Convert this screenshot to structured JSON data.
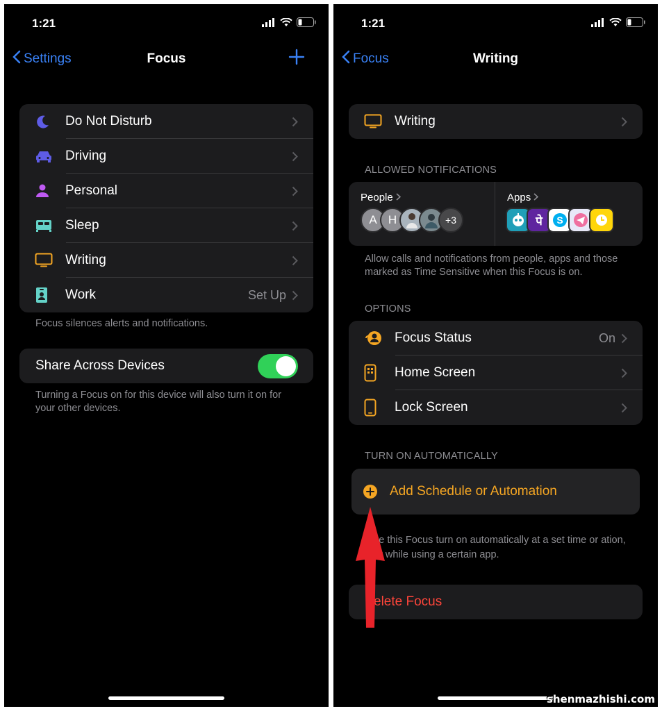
{
  "colors": {
    "accent_blue": "#3a82f7",
    "accent_orange": "#f5a623",
    "destructive_red": "#ff453a",
    "toggle_green": "#30d158"
  },
  "left": {
    "status": {
      "time": "1:21"
    },
    "nav": {
      "back_label": "Settings",
      "title": "Focus"
    },
    "focus_items": [
      {
        "label": "Do Not Disturb",
        "icon": "moon-icon",
        "value": ""
      },
      {
        "label": "Driving",
        "icon": "car-icon",
        "value": ""
      },
      {
        "label": "Personal",
        "icon": "person-icon",
        "value": ""
      },
      {
        "label": "Sleep",
        "icon": "bed-icon",
        "value": ""
      },
      {
        "label": "Writing",
        "icon": "monitor-icon",
        "value": ""
      },
      {
        "label": "Work",
        "icon": "badge-icon",
        "value": "Set Up"
      }
    ],
    "focus_footnote": "Focus silences alerts and notifications.",
    "share": {
      "label": "Share Across Devices",
      "enabled": true
    },
    "share_footnote": "Turning a Focus on for this device will also turn it on for your other devices."
  },
  "right": {
    "status": {
      "time": "1:21"
    },
    "nav": {
      "back_label": "Focus",
      "title": "Writing"
    },
    "name_row": {
      "label": "Writing",
      "icon": "monitor-icon"
    },
    "allowed_header": "ALLOWED NOTIFICATIONS",
    "people": {
      "label": "People",
      "avatars": [
        "A",
        "H",
        "",
        ""
      ],
      "more": "+3"
    },
    "apps": {
      "label": "Apps",
      "icons": [
        "robot-app-icon",
        "phonepe-app-icon",
        "skype-app-icon",
        "telegram-app-icon",
        "clock-app-icon"
      ]
    },
    "allowed_footnote": "Allow calls and notifications from people, apps and those marked as Time Sensitive when this Focus is on.",
    "options_header": "OPTIONS",
    "options": [
      {
        "label": "Focus Status",
        "icon": "focus-status-icon",
        "value": "On"
      },
      {
        "label": "Home Screen",
        "icon": "home-screen-icon",
        "value": ""
      },
      {
        "label": "Lock Screen",
        "icon": "lock-screen-icon",
        "value": ""
      }
    ],
    "auto_header": "TURN ON AUTOMATICALLY",
    "add_schedule": "Add Schedule or Automation",
    "auto_footnote": "ve this Focus turn on automatically at a set time or ation, or while using a certain app.",
    "delete": "elete Focus"
  },
  "watermark": "shenmazhishi.com"
}
